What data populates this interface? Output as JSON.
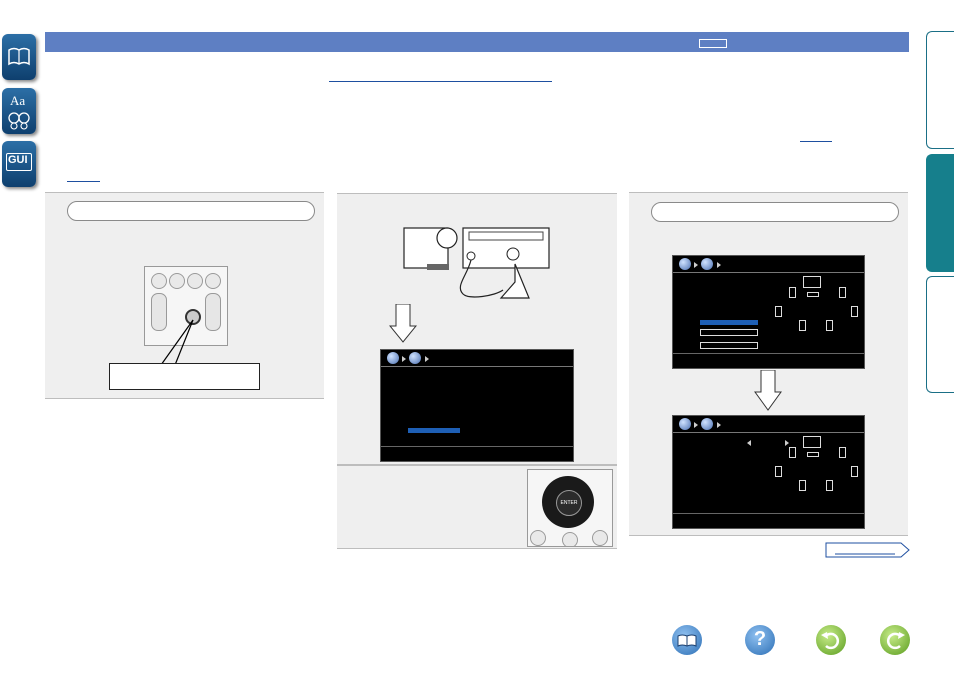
{
  "side_icons": [
    "book-icon",
    "glossary-icon",
    "gui-icon"
  ],
  "side_icon_labels": {
    "glossary": "Aa",
    "gui": "GUI"
  },
  "right_tabs": [
    "tab-top",
    "tab-middle-active",
    "tab-bottom"
  ],
  "remote_enter_label": "ENTER",
  "next_page_label": "",
  "bottom_nav": [
    "book-nav-icon",
    "help-nav-icon",
    "back-nav-icon",
    "forward-nav-icon"
  ],
  "colors": {
    "header_bar": "#5e7fc3",
    "active_tab": "#167f8c",
    "link": "#1e4fa0",
    "highlight": "#1e5fb5"
  }
}
